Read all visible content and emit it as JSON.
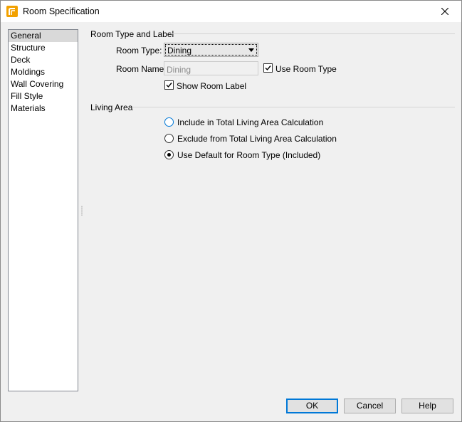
{
  "window": {
    "title": "Room Specification"
  },
  "sidebar": {
    "items": [
      {
        "label": "General"
      },
      {
        "label": "Structure"
      },
      {
        "label": "Deck"
      },
      {
        "label": "Moldings"
      },
      {
        "label": "Wall Covering"
      },
      {
        "label": "Fill Style"
      },
      {
        "label": "Materials"
      }
    ],
    "selected": "General"
  },
  "room_type_group": {
    "title": "Room Type and Label",
    "room_type_label": "Room Type:",
    "room_type_value": "Dining",
    "room_name_label": "Room Name:",
    "room_name_value": "Dining",
    "use_room_type_label": "Use Room Type",
    "use_room_type_checked": true,
    "show_room_label_label": "Show Room Label",
    "show_room_label_checked": true
  },
  "living_area_group": {
    "title": "Living Area",
    "options": [
      {
        "label": "Include in Total Living Area Calculation",
        "selected": false
      },
      {
        "label": "Exclude from Total Living Area Calculation",
        "selected": false
      },
      {
        "label": "Use Default for Room Type (Included)",
        "selected": true
      }
    ]
  },
  "buttons": {
    "ok": "OK",
    "cancel": "Cancel",
    "help": "Help"
  },
  "colors": {
    "accent": "#0078d7",
    "app_icon": "#f2a100"
  }
}
